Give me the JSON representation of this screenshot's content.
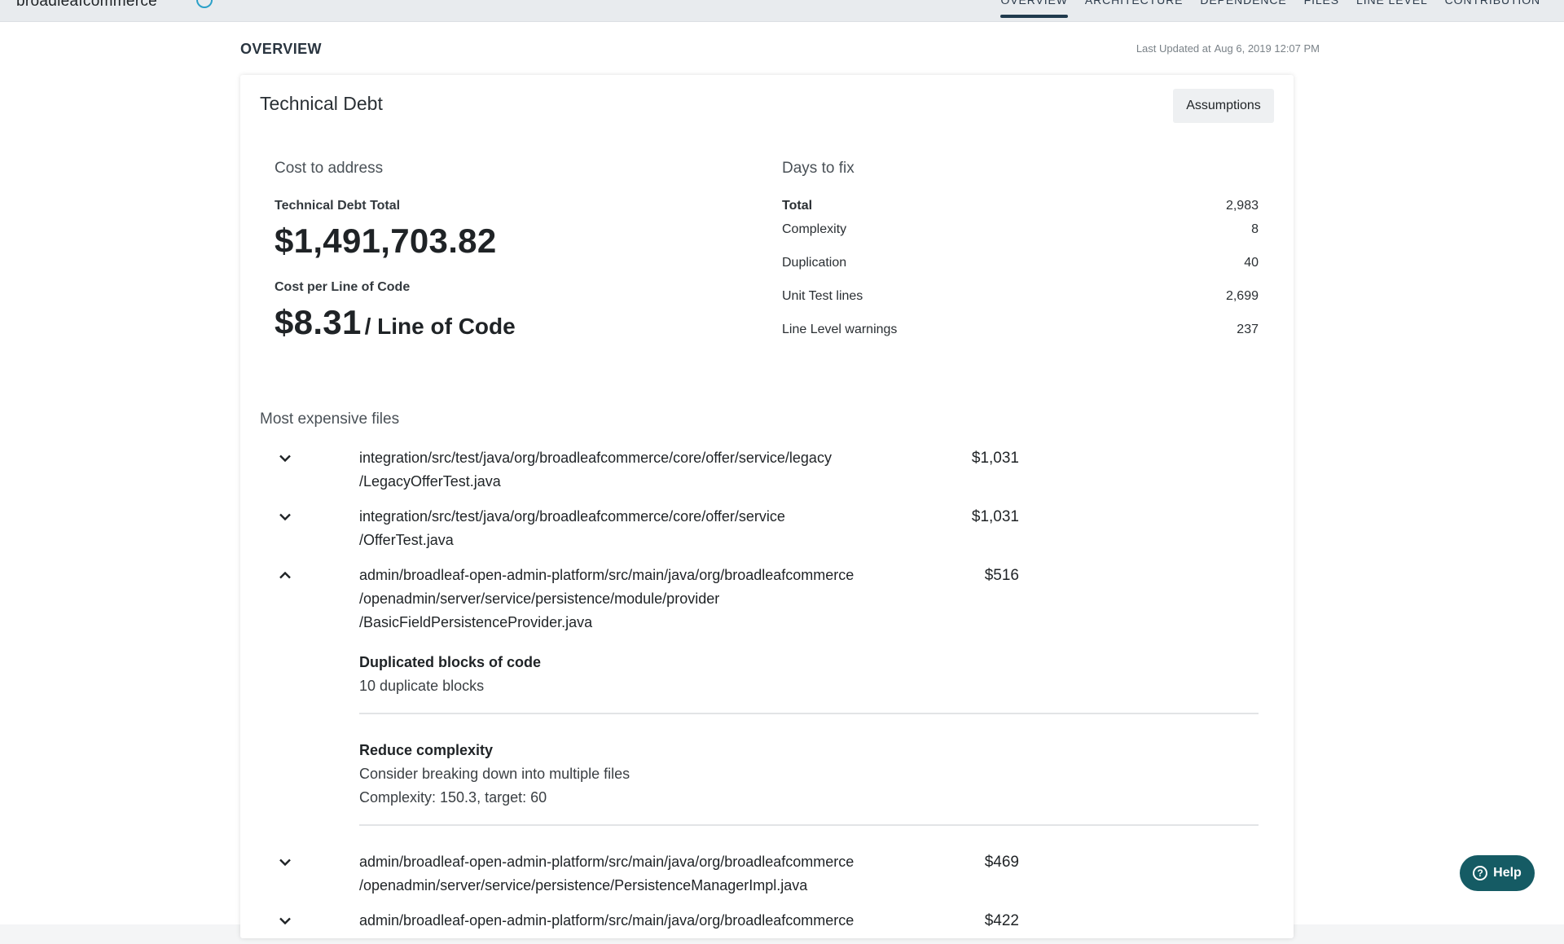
{
  "header": {
    "brand": "broadleafcommerce",
    "nav": [
      {
        "label": "OVERVIEW",
        "active": true
      },
      {
        "label": "ARCHITECTURE",
        "active": false
      },
      {
        "label": "DEPENDENCE",
        "active": false
      },
      {
        "label": "FILES",
        "active": false
      },
      {
        "label": "LINE LEVEL",
        "active": false
      },
      {
        "label": "CONTRIBUTION",
        "active": false
      }
    ]
  },
  "page": {
    "title": "OVERVIEW",
    "last_updated_prefix": "Last Updated at",
    "last_updated_value": "Aug 6, 2019 12:07 PM"
  },
  "card": {
    "title": "Technical Debt",
    "assumptions_label": "Assumptions"
  },
  "cost": {
    "heading": "Cost to address",
    "total_label": "Technical Debt Total",
    "total_value": "$1,491,703.82",
    "per_line_label": "Cost per Line of Code",
    "per_line_value": "$8.31",
    "per_line_unit": "/ Line of Code"
  },
  "days": {
    "heading": "Days to fix",
    "total_label": "Total",
    "total_value": "2,983",
    "items": [
      {
        "label": "Complexity",
        "value": "8"
      },
      {
        "label": "Duplication",
        "value": "40"
      },
      {
        "label": "Unit Test lines",
        "value": "2,699"
      },
      {
        "label": "Line Level warnings",
        "value": "237"
      }
    ]
  },
  "files": {
    "heading": "Most expensive files",
    "items": [
      {
        "path_lines": [
          "integration/src/test/java/org/broadleafcommerce/core/offer/service/legacy",
          "/LegacyOfferTest.java"
        ],
        "cost": "$1,031",
        "expanded": false
      },
      {
        "path_lines": [
          "integration/src/test/java/org/broadleafcommerce/core/offer/service",
          "/OfferTest.java"
        ],
        "cost": "$1,031",
        "expanded": false
      },
      {
        "path_lines": [
          "admin/broadleaf-open-admin-platform/src/main/java/org/broadleafcommerce",
          "/openadmin/server/service/persistence/module/provider",
          "/BasicFieldPersistenceProvider.java"
        ],
        "cost": "$516",
        "expanded": true,
        "details": [
          {
            "title": "Duplicated blocks of code",
            "lines": [
              "10 duplicate blocks"
            ]
          },
          {
            "title": "Reduce complexity",
            "lines": [
              "Consider breaking down into multiple files",
              "Complexity: 150.3, target: 60"
            ]
          }
        ]
      },
      {
        "path_lines": [
          "admin/broadleaf-open-admin-platform/src/main/java/org/broadleafcommerce",
          "/openadmin/server/service/persistence/PersistenceManagerImpl.java"
        ],
        "cost": "$469",
        "expanded": false
      },
      {
        "path_lines": [
          "admin/broadleaf-open-admin-platform/src/main/java/org/broadleafcommerce"
        ],
        "cost": "$422",
        "expanded": false
      }
    ]
  },
  "help": {
    "label": "Help"
  }
}
